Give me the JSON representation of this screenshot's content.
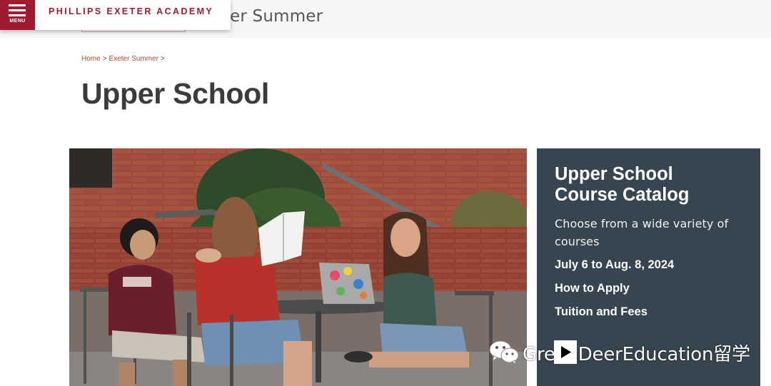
{
  "header": {
    "menu_label": "MENU",
    "brand": "PHILLIPS EXETER ACADEMY",
    "section_title": "er Summer"
  },
  "breadcrumb": {
    "home": "Home",
    "exeter_summer": "Exeter Summer",
    "sep1": ">",
    "sep2": ">"
  },
  "page": {
    "title": "Upper School"
  },
  "panel": {
    "title_line1": "Upper School",
    "title_line2": "Course Catalog",
    "description": "Choose from a wide variety of courses",
    "dates": "July 6 to Aug. 8, 2024",
    "apply_link": "How to Apply",
    "tuition_link": "Tuition and Fees"
  },
  "watermark": {
    "text": "GreenDeerEducation留学"
  },
  "colors": {
    "brand_red": "#9e1b32",
    "panel_bg": "#36454f",
    "breadcrumb_link": "#b5442e",
    "title_text": "#3b3b3b"
  },
  "icons": {
    "menu": "hamburger-icon",
    "watermark": "wechat-icon",
    "play": "play-icon"
  }
}
